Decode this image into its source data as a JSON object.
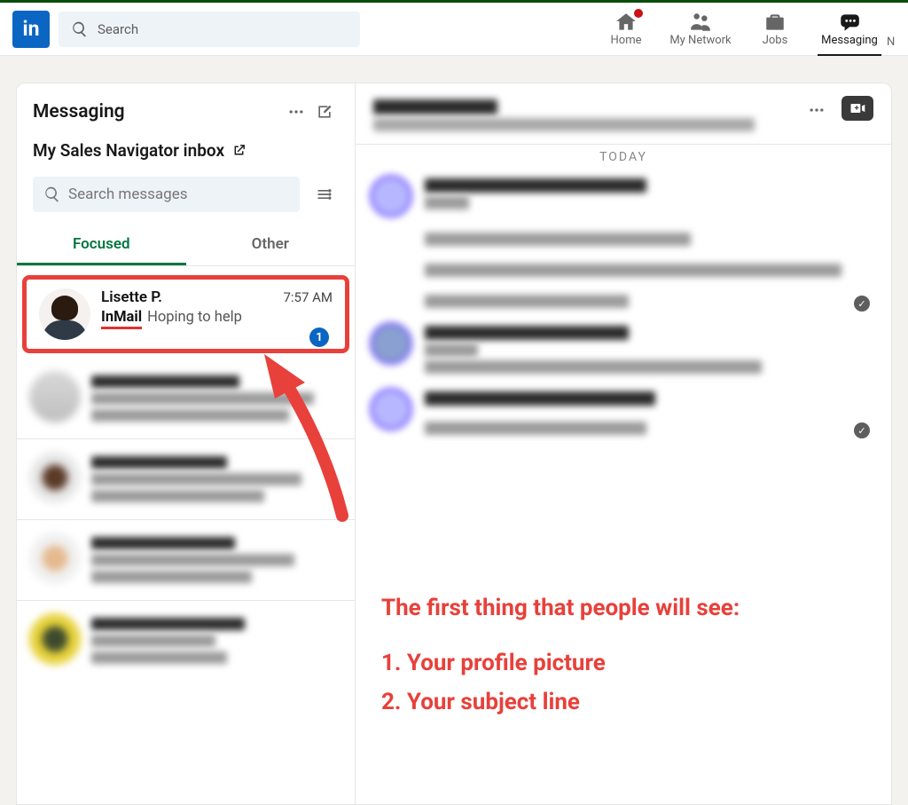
{
  "topnav": {
    "search_placeholder": "Search",
    "items": [
      {
        "label": "Home"
      },
      {
        "label": "My Network"
      },
      {
        "label": "Jobs"
      },
      {
        "label": "Messaging"
      }
    ]
  },
  "messaging": {
    "title": "Messaging",
    "sales_nav_label": "My Sales Navigator inbox",
    "search_placeholder": "Search messages",
    "tabs": {
      "focused": "Focused",
      "other": "Other"
    },
    "threads": [
      {
        "name": "Lisette P.",
        "time": "7:57 AM",
        "badge": "InMail",
        "preview": "Hoping to help",
        "unread_count": "1"
      }
    ],
    "today_label": "TODAY"
  },
  "annotation": {
    "line1": "The first thing that people will see:",
    "line2": "1. Your profile picture",
    "line3": "2. Your subject line"
  }
}
